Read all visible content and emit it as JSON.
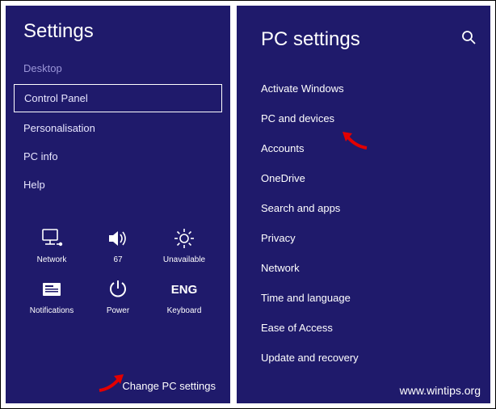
{
  "left": {
    "title": "Settings",
    "items": [
      {
        "label": "Desktop",
        "faded": true
      },
      {
        "label": "Control Panel",
        "selected": true
      },
      {
        "label": "Personalisation"
      },
      {
        "label": "PC info"
      },
      {
        "label": "Help"
      }
    ],
    "tiles": {
      "network": "Network",
      "volume": "67",
      "brightness": "Unavailable",
      "notifications": "Notifications",
      "power": "Power",
      "keyboard_lang": "ENG",
      "keyboard": "Keyboard"
    },
    "change_link": "Change PC settings"
  },
  "right": {
    "title": "PC settings",
    "items": [
      "Activate Windows",
      "PC and devices",
      "Accounts",
      "OneDrive",
      "Search and apps",
      "Privacy",
      "Network",
      "Time and language",
      "Ease of Access",
      "Update and recovery"
    ]
  },
  "watermark": "www.wintips.org"
}
